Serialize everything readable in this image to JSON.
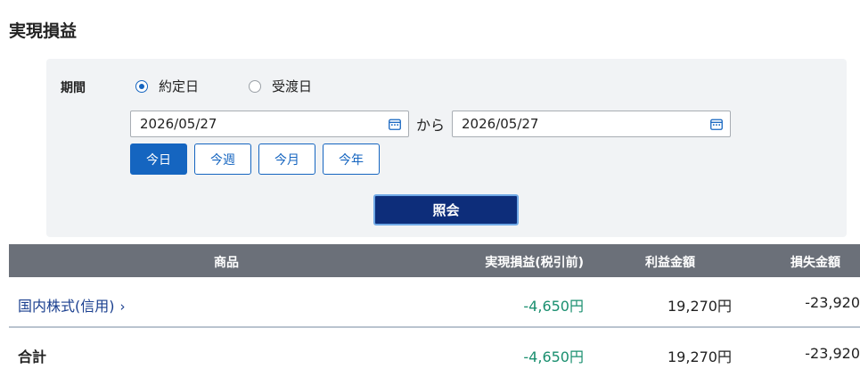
{
  "page": {
    "title": "実現損益"
  },
  "filter": {
    "period_label": "期間",
    "radio_options": [
      {
        "label": "約定日",
        "selected": true
      },
      {
        "label": "受渡日",
        "selected": false
      }
    ],
    "date_from": "2026/05/27",
    "date_to": "2026/05/27",
    "separator": "から",
    "quick_buttons": [
      {
        "label": "今日",
        "active": true
      },
      {
        "label": "今週",
        "active": false
      },
      {
        "label": "今月",
        "active": false
      },
      {
        "label": "今年",
        "active": false
      }
    ],
    "query_label": "照会"
  },
  "table": {
    "headers": {
      "product": "商品",
      "realized": "実現損益(税引前)",
      "profit": "利益金額",
      "loss": "損失金額"
    },
    "rows": [
      {
        "product": "国内株式(信用)",
        "realized": "-4,650円",
        "profit": "19,270円",
        "loss": "-23,920"
      }
    ],
    "total": {
      "label": "合計",
      "realized": "-4,650円",
      "profit": "19,270円",
      "loss": "-23,920"
    }
  },
  "colors": {
    "primary": "#1565c0",
    "query_button": "#0d2d7a",
    "header_bg": "#6b7079",
    "realized_text": "#1a8f6f",
    "panel_bg": "#f1f3f5"
  }
}
